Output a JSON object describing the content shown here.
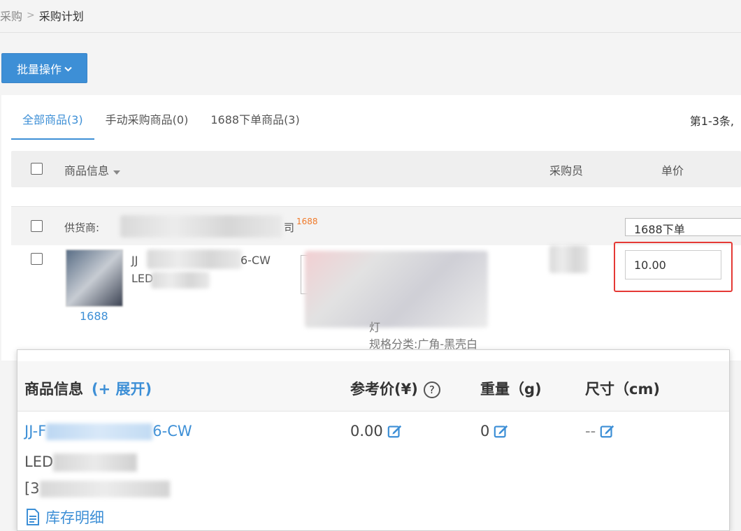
{
  "breadcrumb": {
    "parent": "采购",
    "separator": ">",
    "current": "采购计划"
  },
  "toolbar": {
    "batch_label": "批量操作"
  },
  "tabs": [
    {
      "label": "全部商品(3)",
      "active": true
    },
    {
      "label": "手动采购商品(0)",
      "active": false
    },
    {
      "label": "1688下单商品(3)",
      "active": false
    }
  ],
  "pagination": {
    "info": "第1-3条,"
  },
  "table": {
    "headers": {
      "product_info": "商品信息",
      "buyer": "采购员",
      "unit_price": "单价"
    }
  },
  "group": {
    "supplier_label": "供货商:",
    "supplier_suffix": "司",
    "platform_tag": "1688",
    "order_type": "1688下单"
  },
  "item": {
    "sku_prefix": "JJ",
    "sku_suffix": "6-CW",
    "name_prefix": "LED",
    "source_link": "1688",
    "spec_partial": "灯",
    "spec": "规格分类:广角-黑壳白",
    "unit_price_value": "10.00"
  },
  "popup": {
    "headers": {
      "product_info": "商品信息",
      "expand": "(+ 展开)",
      "ref_price": "参考价(¥)",
      "help": "?",
      "weight": "重量（g)",
      "size": "尺寸（cm)"
    },
    "sku_prefix": "JJ-F",
    "sku_suffix": "6-CW",
    "name_prefix": "LED",
    "code_prefix": "[3",
    "ref_price_value": "0.00",
    "weight_value": "0",
    "size_value": "--",
    "stock_link": "库存明细"
  },
  "colors": {
    "primary": "#3d8fd6",
    "highlight_border": "#e53935",
    "tag": "#f07a2a"
  }
}
